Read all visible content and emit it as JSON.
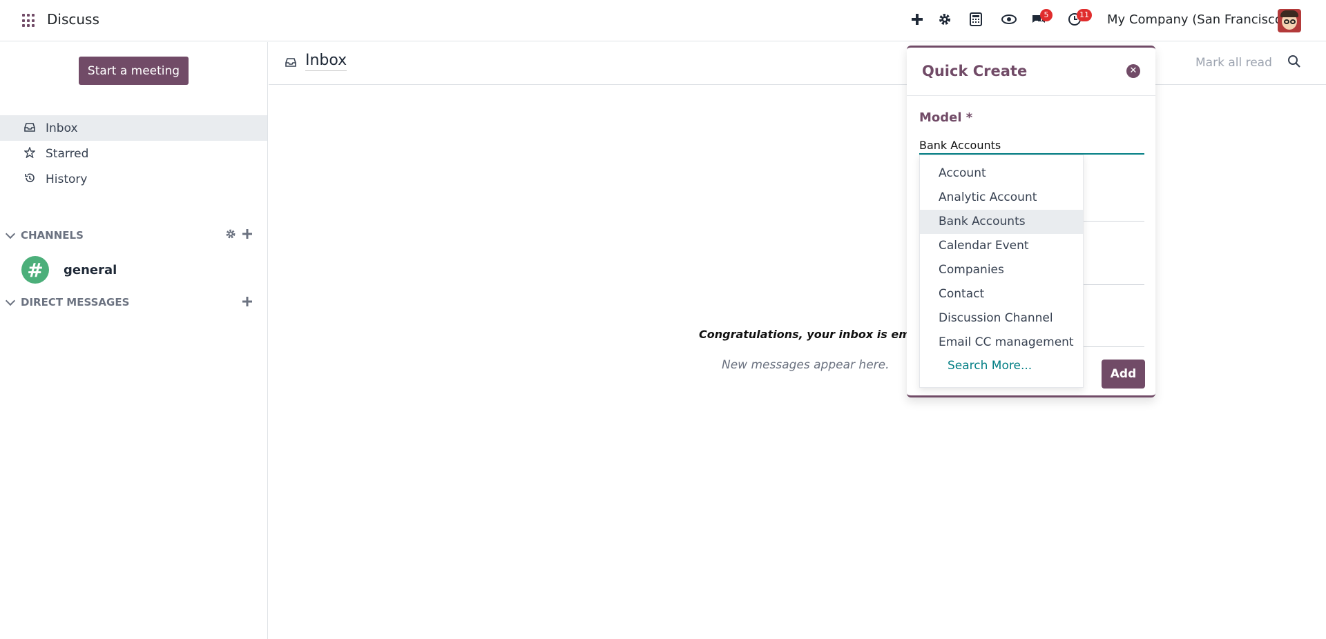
{
  "app": {
    "title": "Discuss"
  },
  "systray": {
    "messages_count": "5",
    "activities_count": "11",
    "company": "My Company (San Francisco)"
  },
  "sidebar": {
    "start_meeting": "Start a meeting",
    "items": [
      {
        "label": "Inbox"
      },
      {
        "label": "Starred"
      },
      {
        "label": "History"
      }
    ],
    "channels_header": "CHANNELS",
    "channels": [
      {
        "name": "general"
      }
    ],
    "dm_header": "DIRECT MESSAGES"
  },
  "main": {
    "title": "Inbox",
    "mark_all_read": "Mark all read",
    "empty_title": "Congratulations, your inbox is empty",
    "empty_subtitle": "New messages appear here."
  },
  "quick_create": {
    "title": "Quick Create",
    "model_label": "Model *",
    "model_value": "Bank Accounts",
    "add_label": "Add",
    "options": [
      "Account",
      "Analytic Account",
      "Bank Accounts",
      "Calendar Event",
      "Companies",
      "Contact",
      "Discussion Channel",
      "Email CC management"
    ],
    "highlighted_index": 2,
    "search_more": "Search More..."
  },
  "colors": {
    "brand": "#714b67",
    "accent": "#017e84",
    "badge": "#e02d2d"
  }
}
